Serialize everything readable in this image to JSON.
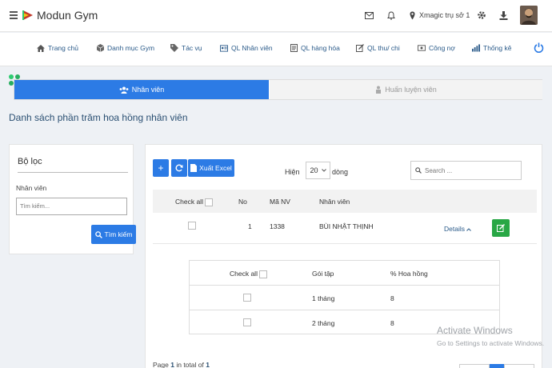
{
  "header": {
    "brand": "Modun Gym",
    "branch": "Xmagic trụ sở 1",
    "icons": [
      "menu-icon",
      "logo-icon",
      "mail-icon",
      "bell-icon",
      "location-pin-icon",
      "gear-icon",
      "download-icon",
      "avatar"
    ]
  },
  "nav": {
    "items": [
      {
        "label": "Trang chủ",
        "icon": "home-icon"
      },
      {
        "label": "Danh mục Gym",
        "icon": "cube-icon"
      },
      {
        "label": "Tác vụ",
        "icon": "tag-icon"
      },
      {
        "label": "QL Nhân viên",
        "icon": "id-card-icon"
      },
      {
        "label": "QL hàng hóa",
        "icon": "document-icon"
      },
      {
        "label": "QL thu/ chi",
        "icon": "edit-icon"
      },
      {
        "label": "Công nợ",
        "icon": "money-icon"
      },
      {
        "label": "Thống kê",
        "icon": "bar-chart-icon"
      }
    ]
  },
  "tabs": {
    "active": "Nhân viên",
    "inactive": "Huấn luyện viên"
  },
  "page": {
    "title": "Danh sách phần trăm hoa hồng nhân viên"
  },
  "filter": {
    "title": "Bộ lọc",
    "field_label": "Nhân viên",
    "placeholder": "Tìm kiếm...",
    "search_button": "Tìm kiếm"
  },
  "toolbar": {
    "excel_label": "Xuất Excel",
    "show_label": "Hiện",
    "page_size": "20",
    "show_unit": "dòng",
    "search_placeholder": "Search ..."
  },
  "table": {
    "headers": {
      "check_all": "Check all",
      "no": "No",
      "code": "Mã NV",
      "name": "Nhân viên"
    },
    "rows": [
      {
        "no": "1",
        "code": "1338",
        "name": "BÙI NHẬT THỊNH",
        "details": "Details"
      }
    ]
  },
  "subtable": {
    "headers": {
      "check_all": "Check all",
      "package": "Gói tập",
      "percent": "% Hoa hồng"
    },
    "rows": [
      {
        "package": "1 tháng",
        "percent": "8"
      },
      {
        "package": "2 tháng",
        "percent": "8"
      }
    ]
  },
  "pagination": {
    "prefix": "Page",
    "current": "1",
    "middle": "in total of",
    "total": "1"
  },
  "watermark": {
    "line1": "Activate Windows",
    "line2": "Go to Settings to activate Windows."
  },
  "colors": {
    "primary": "#2c7be5",
    "success": "#28a745",
    "title": "#2a4f72"
  }
}
